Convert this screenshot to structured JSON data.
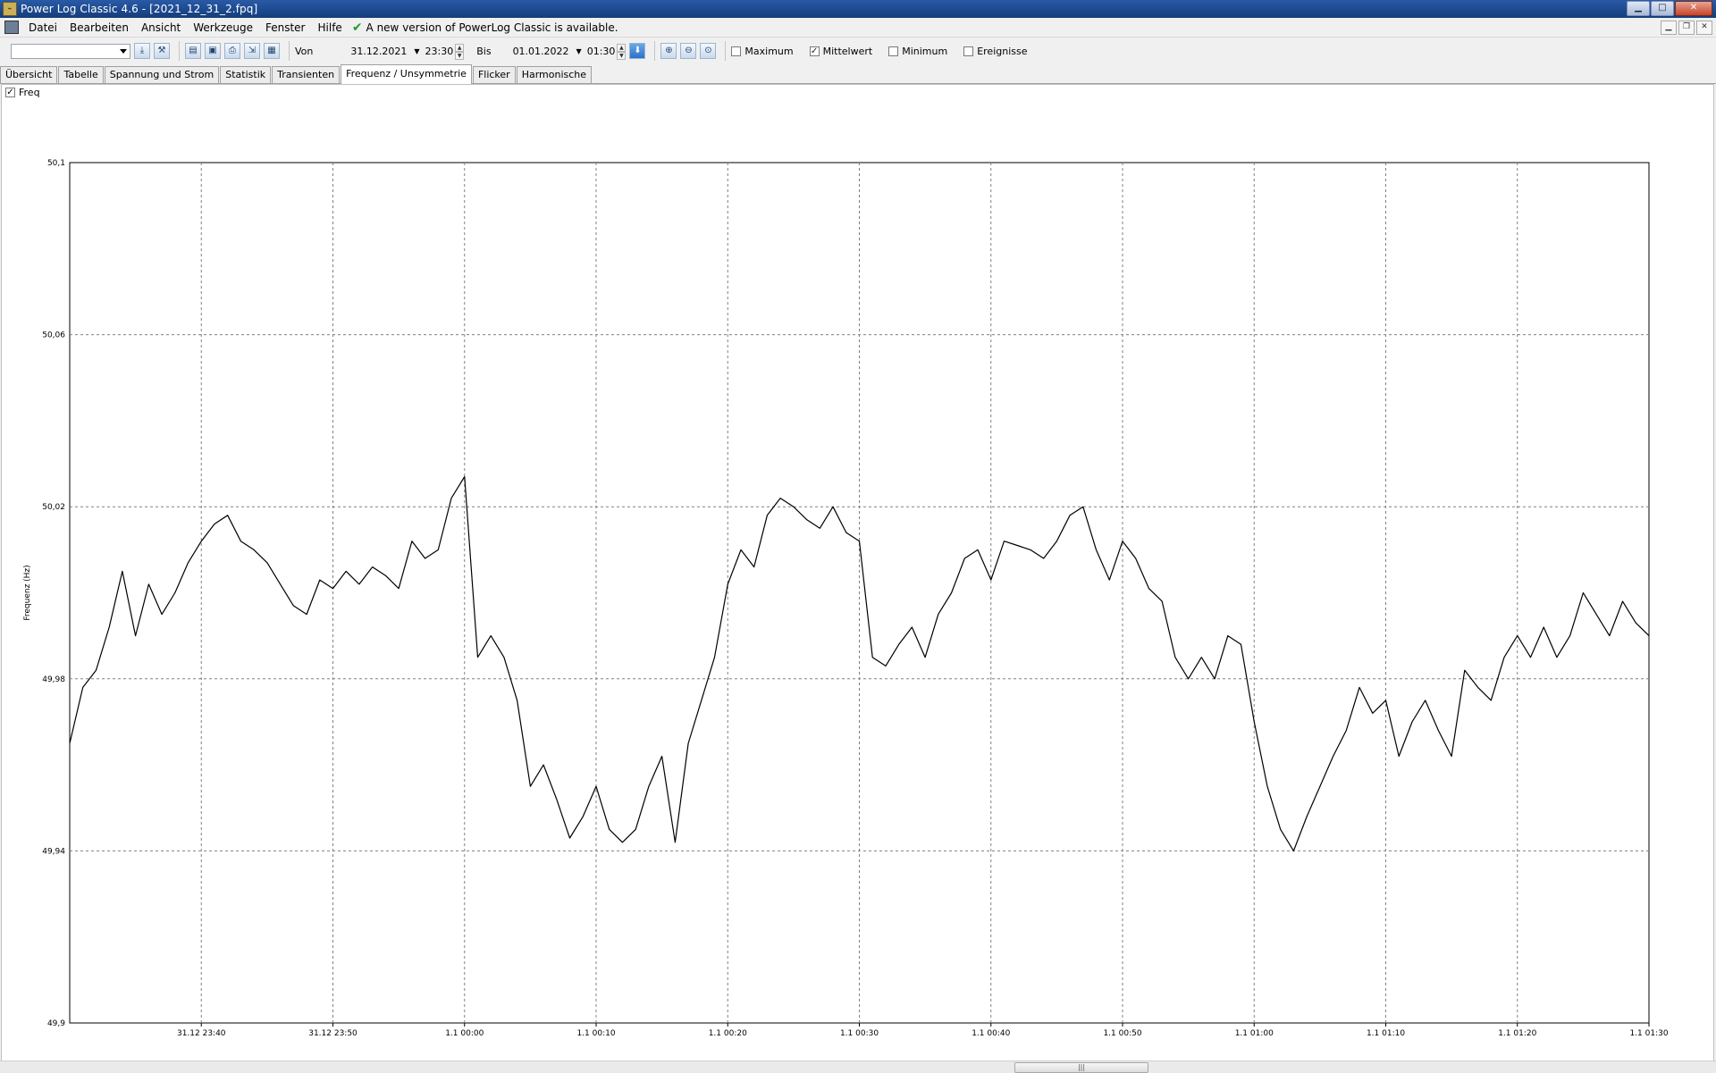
{
  "window": {
    "title": "Power Log Classic 4.6 - [2021_12_31_2.fpq]",
    "app_icon": "app-icon",
    "buttons": [
      "minimize",
      "maximize",
      "close"
    ]
  },
  "menu": {
    "items": [
      "Datei",
      "Bearbeiten",
      "Ansicht",
      "Werkzeuge",
      "Fenster",
      "Hilfe"
    ],
    "update_notice": "A new version of PowerLog Classic is available."
  },
  "toolbar": {
    "selector_value": "",
    "from_label": "Von",
    "from_date": "31.12.2021",
    "from_time": "23:30",
    "to_label": "Bis",
    "to_date": "01.01.2022",
    "to_time": "01:30",
    "checkboxes": [
      {
        "label": "Maximum",
        "checked": false
      },
      {
        "label": "Mittelwert",
        "checked": true
      },
      {
        "label": "Minimum",
        "checked": false
      },
      {
        "label": "Ereignisse",
        "checked": false
      }
    ]
  },
  "tabs": [
    "Übersicht",
    "Tabelle",
    "Spannung und Strom",
    "Statistik",
    "Transienten",
    "Frequenz / Unsymmetrie",
    "Flicker",
    "Harmonische"
  ],
  "active_tab": "Frequenz / Unsymmetrie",
  "series_toggle": {
    "label": "Freq",
    "checked": true
  },
  "colors": {
    "line": "#000000",
    "grid": "#808080",
    "background": "#ffffff",
    "titlebar": "#1d4a8f"
  },
  "chart_data": {
    "type": "line",
    "title": "",
    "xlabel": "",
    "ylabel": "Frequenz (Hz)",
    "ylim": [
      49.9,
      50.1
    ],
    "y_ticks": [
      "49,9",
      "49,94",
      "49,98",
      "50,02",
      "50,06",
      "50,1"
    ],
    "x_tick_labels": [
      "31.12 23:40",
      "31.12 23:50",
      "1.1 00:00",
      "1.1 00:10",
      "1.1 00:20",
      "1.1 00:30",
      "1.1 00:40",
      "1.1 00:50",
      "1.1 01:00",
      "1.1 01:10",
      "1.1 01:20",
      "1.1 01:30"
    ],
    "x_range": [
      "31.12 23:30",
      "1.1 01:30"
    ],
    "grid": true,
    "legend": "none",
    "series": [
      {
        "name": "Freq",
        "x": [
          "31.12 23:30",
          "31.12 23:31",
          "31.12 23:32",
          "31.12 23:33",
          "31.12 23:34",
          "31.12 23:35",
          "31.12 23:36",
          "31.12 23:37",
          "31.12 23:38",
          "31.12 23:39",
          "31.12 23:40",
          "31.12 23:41",
          "31.12 23:42",
          "31.12 23:43",
          "31.12 23:44",
          "31.12 23:45",
          "31.12 23:46",
          "31.12 23:47",
          "31.12 23:48",
          "31.12 23:49",
          "31.12 23:50",
          "31.12 23:51",
          "31.12 23:52",
          "31.12 23:53",
          "31.12 23:54",
          "31.12 23:55",
          "31.12 23:56",
          "31.12 23:57",
          "31.12 23:58",
          "31.12 23:59",
          "1.1 00:00",
          "1.1 00:01",
          "1.1 00:02",
          "1.1 00:03",
          "1.1 00:04",
          "1.1 00:05",
          "1.1 00:06",
          "1.1 00:07",
          "1.1 00:08",
          "1.1 00:09",
          "1.1 00:10",
          "1.1 00:11",
          "1.1 00:12",
          "1.1 00:13",
          "1.1 00:14",
          "1.1 00:15",
          "1.1 00:16",
          "1.1 00:17",
          "1.1 00:18",
          "1.1 00:19",
          "1.1 00:20",
          "1.1 00:21",
          "1.1 00:22",
          "1.1 00:23",
          "1.1 00:24",
          "1.1 00:25",
          "1.1 00:26",
          "1.1 00:27",
          "1.1 00:28",
          "1.1 00:29",
          "1.1 00:30",
          "1.1 00:31",
          "1.1 00:32",
          "1.1 00:33",
          "1.1 00:34",
          "1.1 00:35",
          "1.1 00:36",
          "1.1 00:37",
          "1.1 00:38",
          "1.1 00:39",
          "1.1 00:40",
          "1.1 00:41",
          "1.1 00:42",
          "1.1 00:43",
          "1.1 00:44",
          "1.1 00:45",
          "1.1 00:46",
          "1.1 00:47",
          "1.1 00:48",
          "1.1 00:49",
          "1.1 00:50",
          "1.1 00:51",
          "1.1 00:52",
          "1.1 00:53",
          "1.1 00:54",
          "1.1 00:55",
          "1.1 00:56",
          "1.1 00:57",
          "1.1 00:58",
          "1.1 00:59",
          "1.1 01:00",
          "1.1 01:01",
          "1.1 01:02",
          "1.1 01:03",
          "1.1 01:04",
          "1.1 01:05",
          "1.1 01:06",
          "1.1 01:07",
          "1.1 01:08",
          "1.1 01:09",
          "1.1 01:10",
          "1.1 01:11",
          "1.1 01:12",
          "1.1 01:13",
          "1.1 01:14",
          "1.1 01:15",
          "1.1 01:16",
          "1.1 01:17",
          "1.1 01:18",
          "1.1 01:19",
          "1.1 01:20",
          "1.1 01:21",
          "1.1 01:22",
          "1.1 01:23",
          "1.1 01:24",
          "1.1 01:25",
          "1.1 01:26",
          "1.1 01:27",
          "1.1 01:28",
          "1.1 01:29",
          "1.1 01:30"
        ],
        "values": [
          49.965,
          49.978,
          49.982,
          49.992,
          50.005,
          49.99,
          50.002,
          49.995,
          50.0,
          50.007,
          50.012,
          50.016,
          50.018,
          50.012,
          50.01,
          50.007,
          50.002,
          49.997,
          49.995,
          50.003,
          50.001,
          50.005,
          50.002,
          50.006,
          50.004,
          50.001,
          50.012,
          50.008,
          50.01,
          50.022,
          50.027,
          49.985,
          49.99,
          49.985,
          49.975,
          49.955,
          49.96,
          49.952,
          49.943,
          49.948,
          49.955,
          49.945,
          49.942,
          49.945,
          49.955,
          49.962,
          49.942,
          49.965,
          49.975,
          49.985,
          50.002,
          50.01,
          50.006,
          50.018,
          50.022,
          50.02,
          50.017,
          50.015,
          50.02,
          50.014,
          50.012,
          49.985,
          49.983,
          49.988,
          49.992,
          49.985,
          49.995,
          50.0,
          50.008,
          50.01,
          50.003,
          50.012,
          50.011,
          50.01,
          50.008,
          50.012,
          50.018,
          50.02,
          50.01,
          50.003,
          50.012,
          50.008,
          50.001,
          49.998,
          49.985,
          49.98,
          49.985,
          49.98,
          49.99,
          49.988,
          49.97,
          49.955,
          49.945,
          49.94,
          49.948,
          49.955,
          49.962,
          49.968,
          49.978,
          49.972,
          49.975,
          49.962,
          49.97,
          49.975,
          49.968,
          49.962,
          49.982,
          49.978,
          49.975,
          49.985,
          49.99,
          49.985,
          49.992,
          49.985,
          49.99,
          50.0,
          49.995,
          49.99,
          49.998,
          49.993,
          49.99
        ]
      }
    ]
  }
}
